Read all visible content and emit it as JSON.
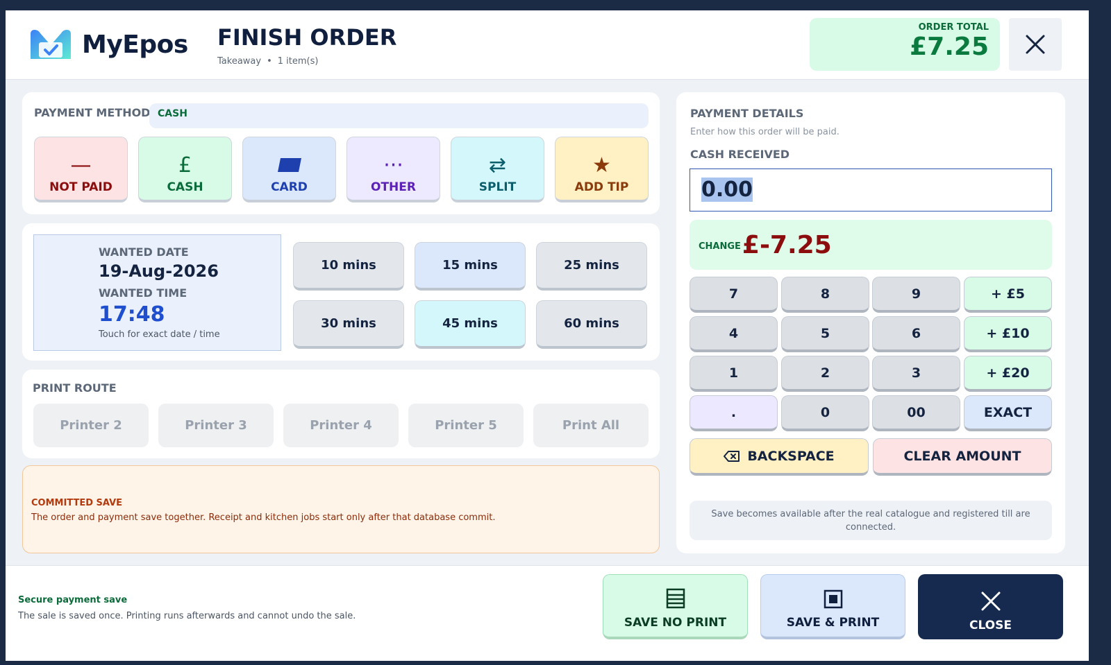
{
  "header": {
    "brand": "MyEpos",
    "title": "FINISH ORDER",
    "order_type": "Takeaway",
    "separator": "•",
    "item_count": "1 item(s)",
    "total_label": "ORDER TOTAL",
    "total_value": "£7.25"
  },
  "payment_method": {
    "label": "PAYMENT METHOD",
    "current": "CASH",
    "buttons": [
      {
        "label": "NOT PAID",
        "icon": "—",
        "icon_name": "dash-icon",
        "bg": "#fde3e3",
        "color": "#8b0d0d"
      },
      {
        "label": "CASH",
        "icon": "£",
        "icon_name": "pound-icon",
        "bg": "#d8fbe7",
        "color": "#0b6b3a"
      },
      {
        "label": "CARD",
        "icon": "",
        "icon_name": "card-icon",
        "bg": "#dbe7fb",
        "color": "#1e40af"
      },
      {
        "label": "OTHER",
        "icon": "···",
        "icon_name": "more-icon",
        "bg": "#ede9ff",
        "color": "#5b21b6"
      },
      {
        "label": "SPLIT",
        "icon": "⇄",
        "icon_name": "swap-icon",
        "bg": "#d4f7fb",
        "color": "#0b5d6b"
      },
      {
        "label": "ADD TIP",
        "icon": "★",
        "icon_name": "star-icon",
        "bg": "#fff1c4",
        "color": "#8b3a0b"
      }
    ]
  },
  "wanted": {
    "date_label": "WANTED DATE",
    "date": "19-Aug-2026",
    "time_label": "WANTED TIME",
    "time": "17:48",
    "hint": "Touch for exact date / time",
    "presets": [
      {
        "label": "10 mins",
        "bg": "#e3e7ec"
      },
      {
        "label": "15 mins",
        "bg": "#dbe7fb"
      },
      {
        "label": "25 mins",
        "bg": "#e3e7ec"
      },
      {
        "label": "30 mins",
        "bg": "#e3e7ec"
      },
      {
        "label": "45 mins",
        "bg": "#d4f7fb"
      },
      {
        "label": "60 mins",
        "bg": "#e3e7ec"
      }
    ]
  },
  "print_route": {
    "label": "PRINT ROUTE",
    "printers": [
      "Printer 2",
      "Printer 3",
      "Printer 4",
      "Printer 5",
      "Print All"
    ]
  },
  "committed": {
    "title": "COMMITTED SAVE",
    "text": "The order and payment save together. Receipt and kitchen jobs start only after that database commit."
  },
  "payment_details": {
    "title": "PAYMENT DETAILS",
    "subtitle": "Enter how this order will be paid.",
    "cash_label": "CASH RECEIVED",
    "cash_value": "0.00",
    "change_label": "CHANGE",
    "change_value": "£-7.25",
    "keypad": [
      [
        "7",
        "8",
        "9",
        "+ £5"
      ],
      [
        "4",
        "5",
        "6",
        "+ £10"
      ],
      [
        "1",
        "2",
        "3",
        "+ £20"
      ],
      [
        ".",
        "0",
        "00",
        "EXACT"
      ]
    ],
    "backspace_label": "BACKSPACE",
    "clear_label": "CLEAR AMOUNT",
    "notice": "Save becomes available after the real catalogue and registered till are connected."
  },
  "footer": {
    "title": "Secure payment save",
    "text": "The sale is saved once. Printing runs afterwards and cannot undo the sale.",
    "save_no_print": "SAVE NO PRINT",
    "save_print": "SAVE & PRINT",
    "close": "CLOSE"
  },
  "colors": {
    "brand_navy": "#0f1f3d",
    "accent_green": "#0b7a3e",
    "change_red": "#8b0d0d",
    "close_bg": "#152a4e"
  }
}
